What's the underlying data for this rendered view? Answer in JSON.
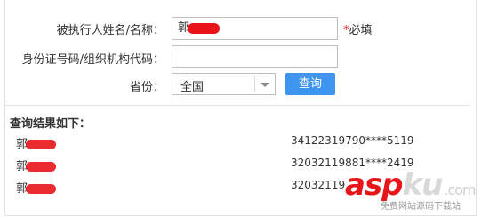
{
  "form": {
    "name_label": "被执行人姓名/名称：",
    "name_value": "郭",
    "required_star": "*",
    "required_text": "必填",
    "id_label": "身份证号码/组织机构代码：",
    "id_value": "",
    "province_label": "省份：",
    "province_value": "全国",
    "search_button": "查询"
  },
  "results": {
    "title": "查询结果如下：",
    "rows": [
      {
        "name": "郭",
        "id_number": "34122319790****5119"
      },
      {
        "name": "郭",
        "id_number": "32032119881****2419"
      },
      {
        "name": "郭",
        "id_number": "32032119"
      }
    ]
  },
  "watermark": {
    "brand_a": "asp",
    "brand_b": "ku",
    "brand_c": ".com",
    "tagline": "免费网站源码下载站"
  },
  "colors": {
    "accent_button": "#3d95f0",
    "required_star": "#e8141a",
    "redaction": "#e8141a"
  }
}
